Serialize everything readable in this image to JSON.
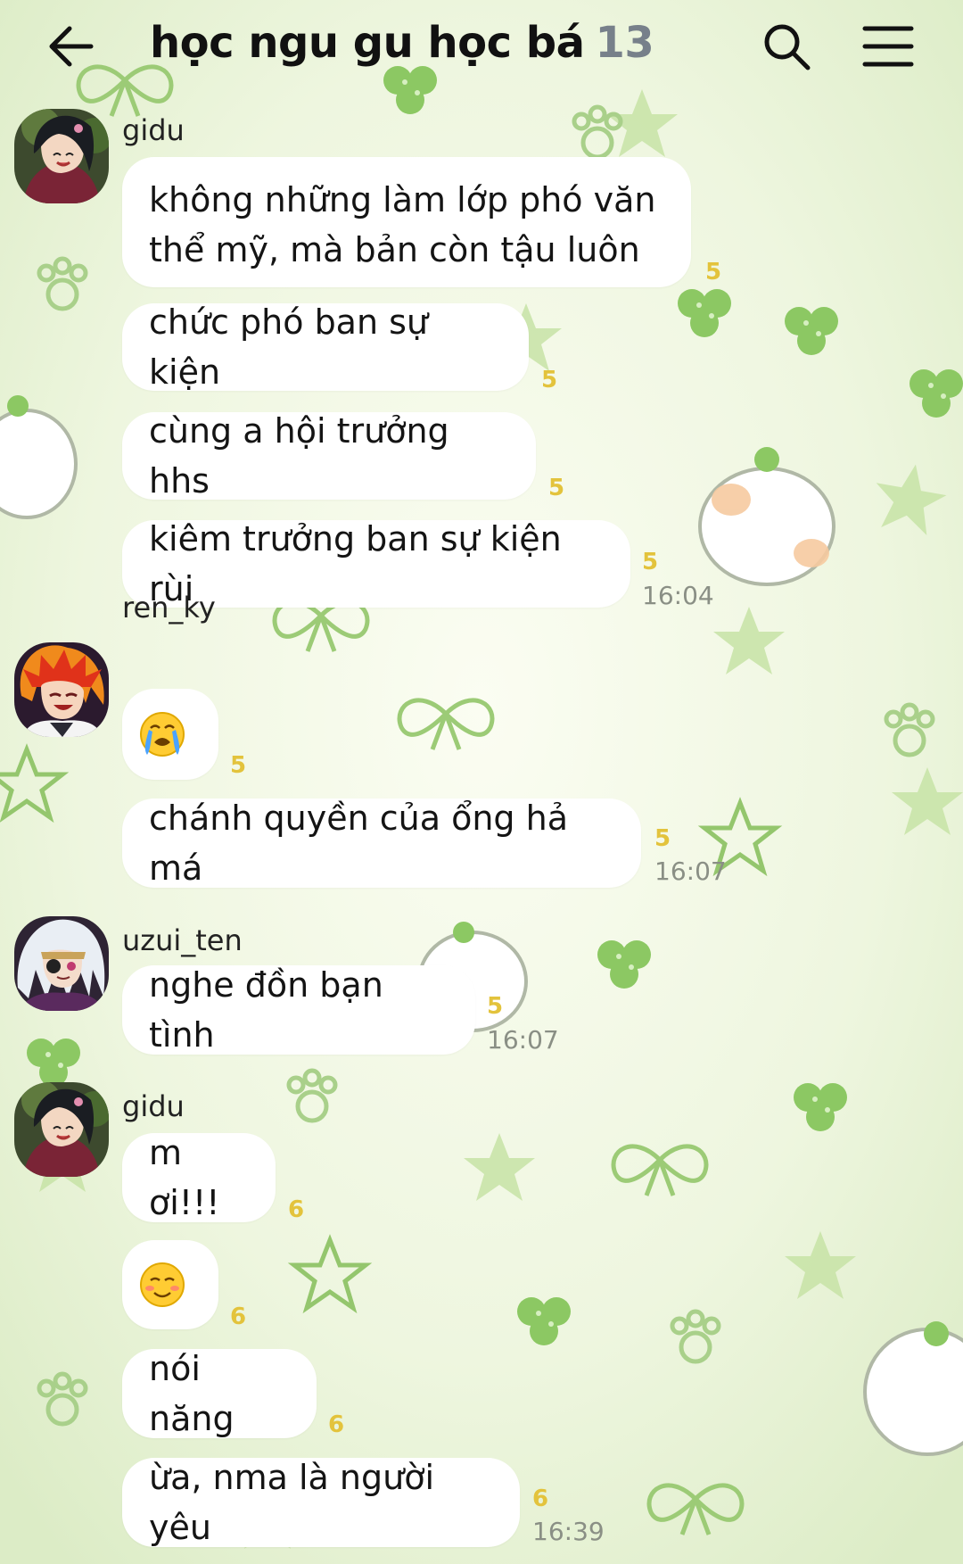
{
  "header": {
    "title": "học ngu gu học bá",
    "member_count": "13"
  },
  "messages": [
    {
      "sender": "gidu",
      "bubbles": [
        {
          "lines": [
            "không những làm lớp phó văn",
            "thể mỹ, mà bản còn tậu luôn"
          ],
          "unread": "5"
        },
        {
          "text": "chức phó ban sự kiện",
          "unread": "5"
        },
        {
          "text": "cùng a hội trưởng hhs",
          "unread": "5"
        },
        {
          "text": "kiêm trưởng ban sự kiện rùi",
          "unread": "5",
          "time": "16:04"
        }
      ]
    },
    {
      "sender": "ren_ky",
      "bubbles": [
        {
          "emoji": "crying-face",
          "unread": "5"
        },
        {
          "text": "chánh quyền của ổng hả má",
          "unread": "5",
          "time": "16:07"
        }
      ]
    },
    {
      "sender": "uzui_ten",
      "bubbles": [
        {
          "text": "nghe đồn bạn tình",
          "unread": "5",
          "time": "16:07"
        }
      ]
    },
    {
      "sender": "gidu",
      "bubbles": [
        {
          "text": "m ơi!!!",
          "unread": "6"
        },
        {
          "emoji": "smiling-blush-face",
          "unread": "6"
        },
        {
          "text": "nói năng",
          "unread": "6"
        },
        {
          "text": "ừa, nma là người yêu",
          "unread": "6",
          "time": "16:39"
        }
      ]
    }
  ],
  "colors": {
    "background": "#eef6df",
    "bubble": "#ffffff",
    "unread_count": "#e3c33c",
    "timestamp": "#8a8f85",
    "accent_green": "#8cc863"
  }
}
